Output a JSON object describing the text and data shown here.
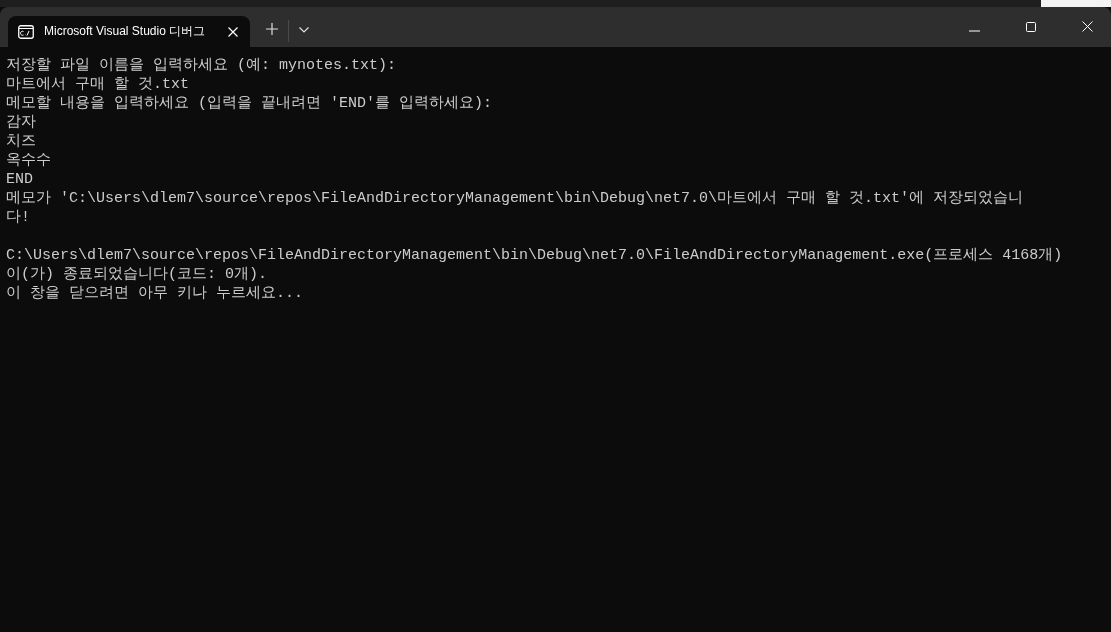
{
  "tabs": [
    {
      "title": "Microsoft Visual Studio 디버그",
      "selected": true
    }
  ],
  "console": {
    "blocks": [
      [
        "저장할 파일 이름을 입력하세요 (예: mynotes.txt):",
        "마트에서 구매 할 것.txt",
        "메모할 내용을 입력하세요 (입력을 끝내려면 'END'를 입력하세요):",
        "감자",
        "치즈",
        "옥수수",
        "END",
        "메모가 'C:\\Users\\dlem7\\source\\repos\\FileAndDirectoryManagement\\bin\\Debug\\net7.0\\마트에서 구매 할 것.txt'에 저장되었습니",
        "다!"
      ],
      [
        "C:\\Users\\dlem7\\source\\repos\\FileAndDirectoryManagement\\bin\\Debug\\net7.0\\FileAndDirectoryManagement.exe(프로세스 4168개)",
        "이(가) 종료되었습니다(코드: 0개).",
        "이 창을 닫으려면 아무 키나 누르세요..."
      ]
    ]
  }
}
